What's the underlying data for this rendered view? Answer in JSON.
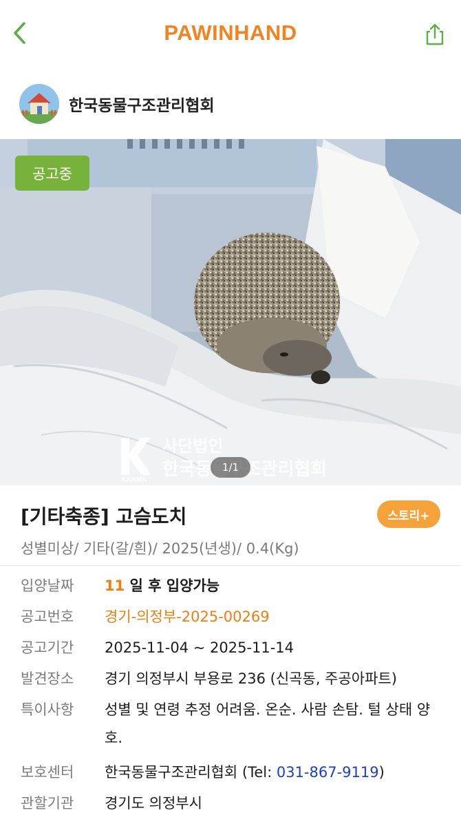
{
  "header": {
    "brand": "PAWINHAND",
    "brand_color": "#f58220",
    "icon_color": "#5cae44",
    "back_icon": "chevron-left-icon",
    "share_icon": "share-icon"
  },
  "shelter": {
    "name": "한국동물구조관리협회",
    "avatar_icon": "house-icon"
  },
  "photo": {
    "status_badge": "공고중",
    "watermark_logo": "KARMA",
    "watermark_line1": "사단법인",
    "watermark_line2": "한국동물구조관리협회",
    "counter": "1/1"
  },
  "pet": {
    "title": "[기타축종] 고슴도치",
    "summary": "성별미상/ 기타(갈/흰)/ 2025(년생)/ 0.4(Kg)",
    "story_button": "스토리+"
  },
  "details": {
    "adoption_label": "입양날짜",
    "adoption_days": "11",
    "adoption_suffix": " 일 후 입양가능",
    "notice_no_label": "공고번호",
    "notice_no": "경기-의정부-2025-00269",
    "period_label": "공고기간",
    "period": "2025-11-04 ~ 2025-11-14",
    "found_label": "발견장소",
    "found_place": "경기 의정부시 부용로 236 (신곡동, 주공아파트)",
    "notes_label": "특이사항",
    "notes": "성별 및 연령 추정 어려움. 온순. 사람 손탐. 털 상태 양호.",
    "center_label": "보호센터",
    "center_name": "한국동물구조관리협회 (Tel: ",
    "center_tel": "031-867-9119",
    "center_close": ")",
    "authority_label": "관할기관",
    "authority": "경기도 의정부시"
  }
}
